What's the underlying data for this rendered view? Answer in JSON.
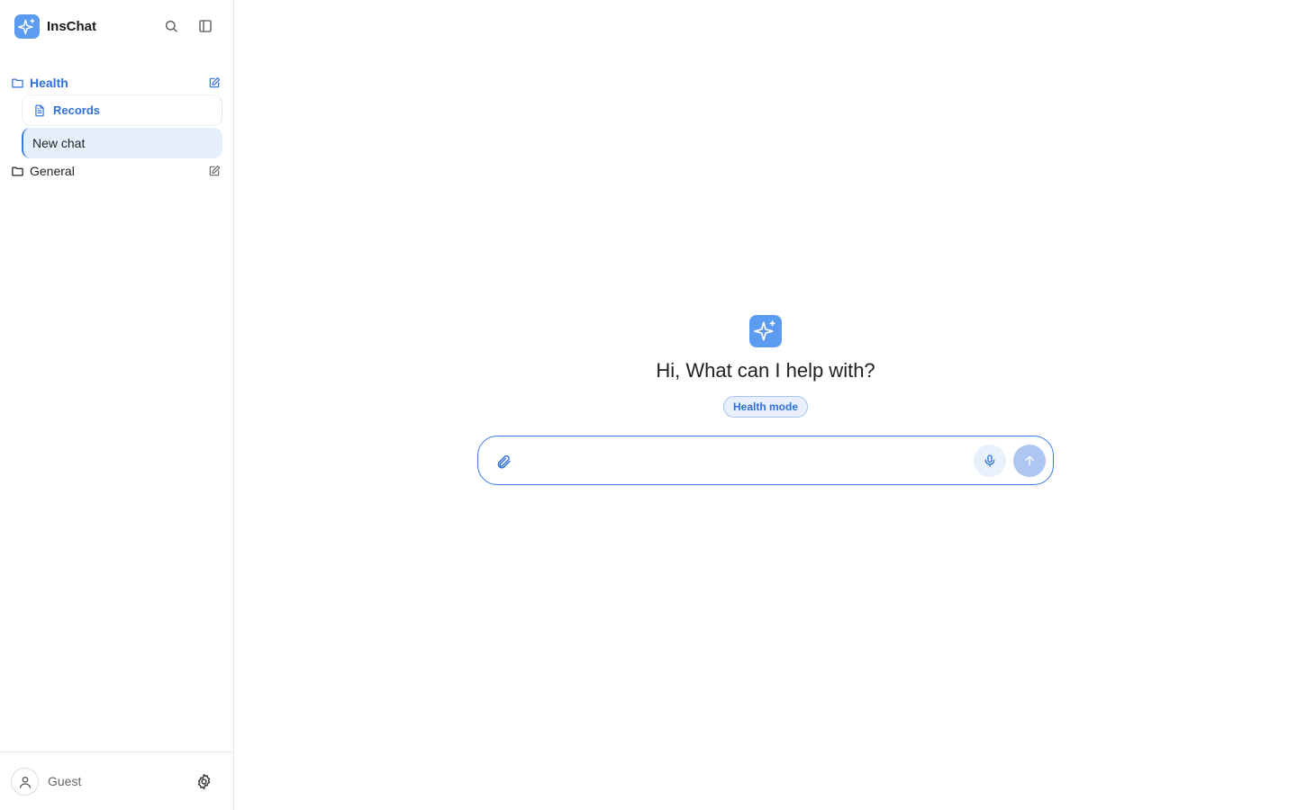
{
  "app": {
    "name": "InsChat"
  },
  "sidebar": {
    "folders": [
      {
        "label": "Health",
        "active": true,
        "items": [
          {
            "label": "Records"
          }
        ]
      },
      {
        "label": "General",
        "active": false
      }
    ],
    "new_chat_label": "New chat",
    "user": {
      "name": "Guest"
    }
  },
  "main": {
    "greeting": "Hi, What can I help with?",
    "mode_badge": "Health mode",
    "composer": {
      "placeholder": "",
      "value": ""
    }
  },
  "colors": {
    "accent": "#3b7be0",
    "brand": "#5b9bf0"
  },
  "icons": [
    "sparkle-icon",
    "search-icon",
    "sidebar-toggle-icon",
    "folder-icon",
    "edit-icon",
    "document-icon",
    "user-icon",
    "gear-icon",
    "paperclip-icon",
    "mic-icon",
    "arrow-up-icon"
  ]
}
